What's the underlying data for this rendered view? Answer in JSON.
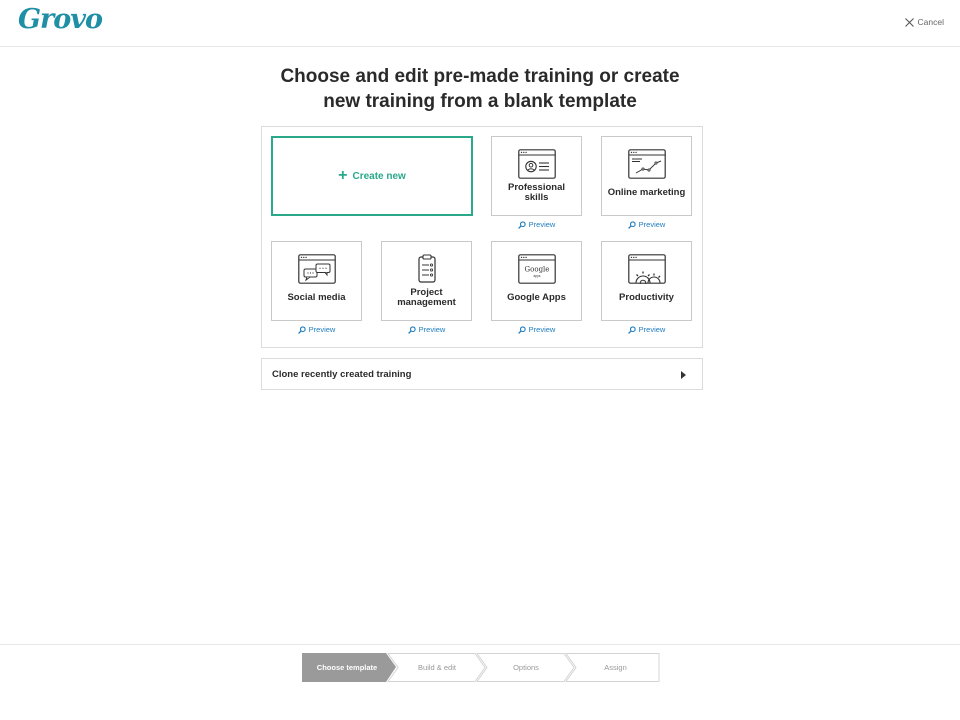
{
  "header": {
    "logo_text": "Grovo",
    "cancel_label": "Cancel",
    "cancel_icon": "close-icon"
  },
  "title": {
    "line1": "Choose and edit pre-made training or create",
    "line2": "new training from a blank template"
  },
  "create_new": {
    "label": "Create new",
    "icon": "plus-icon"
  },
  "templates": [
    {
      "name_line1": "Professional",
      "name_line2": "skills",
      "icon": "profile-card-icon",
      "preview_label": "Preview"
    },
    {
      "name_line1": "Online marketing",
      "name_line2": "",
      "icon": "analytics-chart-icon",
      "preview_label": "Preview"
    },
    {
      "name_line1": "Social media",
      "name_line2": "",
      "icon": "chat-bubbles-icon",
      "preview_label": "Preview"
    },
    {
      "name_line1": "Project",
      "name_line2": "management",
      "icon": "clipboard-checklist-icon",
      "preview_label": "Preview"
    },
    {
      "name_line1": "Google Apps",
      "name_line2": "",
      "icon": "google-apps-icon",
      "icon_text": "Google",
      "icon_subtext": "apps",
      "preview_label": "Preview"
    },
    {
      "name_line1": "Productivity",
      "name_line2": "",
      "icon": "gears-icon",
      "preview_label": "Preview"
    }
  ],
  "clone": {
    "label": "Clone recently created training",
    "icon": "caret-right-icon"
  },
  "stepper": {
    "active_index": 0,
    "steps": [
      "Choose template",
      "Build & edit",
      "Options",
      "Assign"
    ],
    "colors": {
      "active_bg": "#9a9a9a",
      "active_text": "#ffffff",
      "inactive_text": "#9a9a9a",
      "border": "#d4d4d4"
    }
  },
  "colors": {
    "accent_green": "#2aa88a",
    "link_blue": "#1f7dc1",
    "logo_blue": "#1f8fa6"
  }
}
